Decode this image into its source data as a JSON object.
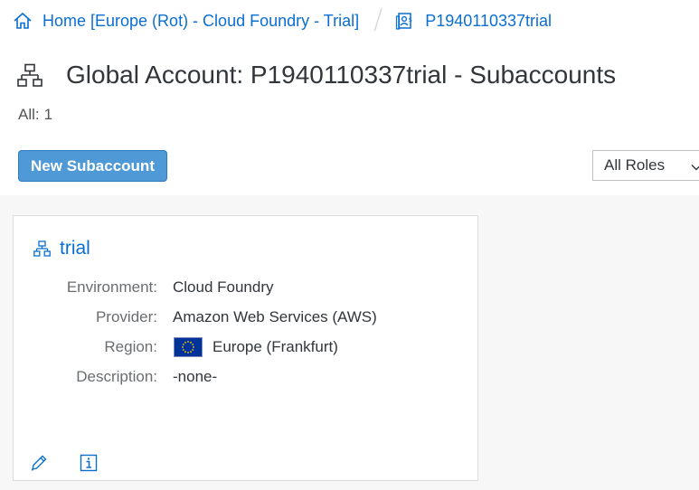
{
  "breadcrumb": {
    "home_label": "Home [Europe (Rot) - Cloud Foundry - Trial]",
    "account_label": "P1940110337trial",
    "separator": "/"
  },
  "header": {
    "title": "Global Account: P1940110337trial - Subaccounts",
    "count_label": "All:",
    "count_value": "1"
  },
  "toolbar": {
    "new_button_label": "New Subaccount",
    "roles_filter_value": "All Roles"
  },
  "subaccounts": [
    {
      "name": "trial",
      "fields": {
        "environment_label": "Environment:",
        "environment_value": "Cloud Foundry",
        "provider_label": "Provider:",
        "provider_value": "Amazon Web Services (AWS)",
        "region_label": "Region:",
        "region_value": "Europe (Frankfurt)",
        "region_flag": "eu-flag-icon",
        "description_label": "Description:",
        "description_value": "-none-"
      },
      "actions": [
        "edit-icon",
        "info-icon"
      ]
    }
  ],
  "colors": {
    "link": "#0a6ed1",
    "primary_button": "#4f9ad6",
    "content_background": "#f7f7f7",
    "text": "#32363a",
    "label": "#6a6d70"
  }
}
